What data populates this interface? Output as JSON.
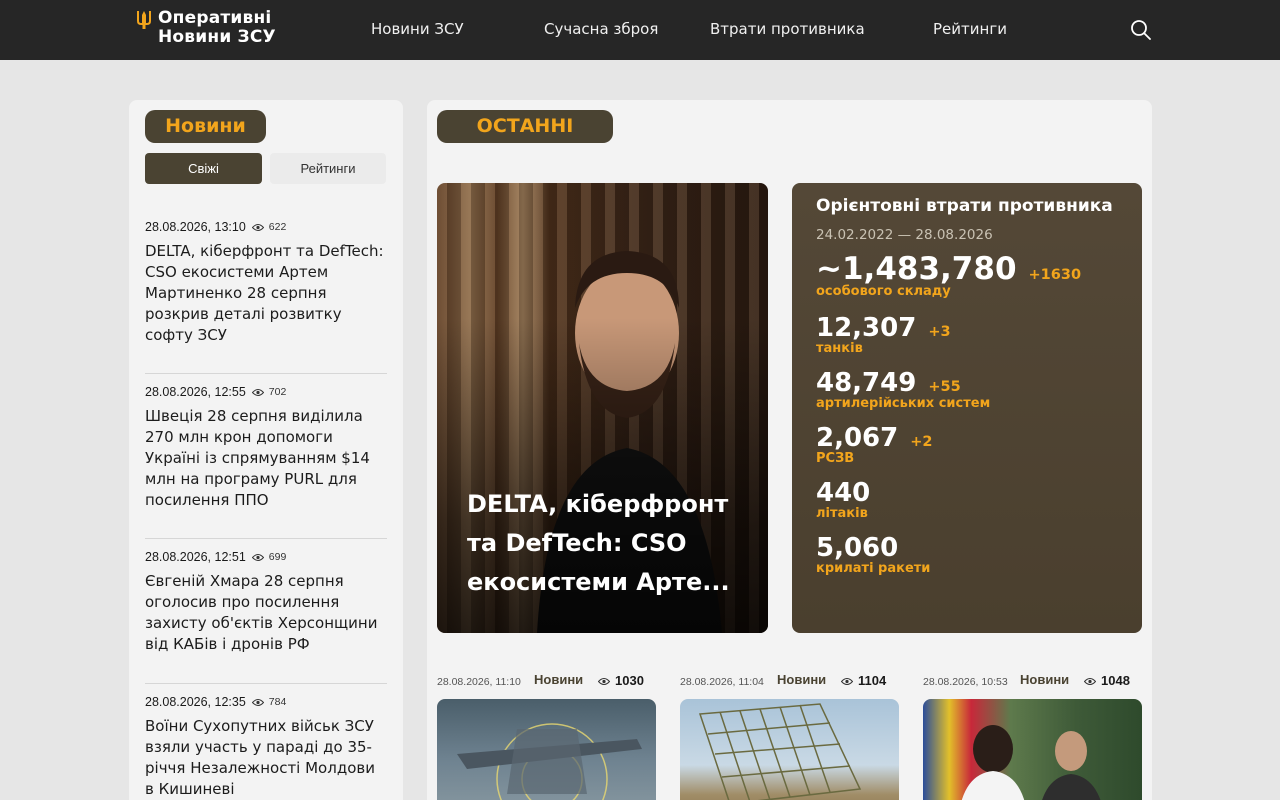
{
  "header": {
    "logo_line1": "Оперативні",
    "logo_line2": "Новини ЗСУ",
    "nav": [
      "Новини ЗСУ",
      "Сучасна зброя",
      "Втрати противника",
      "Рейтинги"
    ],
    "search_icon": "search-icon"
  },
  "sidebar": {
    "title": "Новини",
    "tabs": [
      "Свіжі",
      "Рейтинги"
    ],
    "active_tab": "Свіжі",
    "items": [
      {
        "date": "28.08.2026, 13:10",
        "views": "622",
        "title": "DELTA, кіберфронт та DefTech: CSO екосистеми Артем Мартиненко 28 серпня розкрив деталі розвитку софту ЗСУ"
      },
      {
        "date": "28.08.2026, 12:55",
        "views": "702",
        "title": "Швеція 28 серпня виділила 270 млн крон допомоги Україні із спрямуванням $14 млн на програму PURL для посилення ППО"
      },
      {
        "date": "28.08.2026, 12:51",
        "views": "699",
        "title": "Євгеній Хмара 28 серпня оголосив про посилення захисту об'єктів Херсонщини від КАБів і дронів РФ"
      },
      {
        "date": "28.08.2026, 12:35",
        "views": "784",
        "title": "Воїни Сухопутних військ ЗСУ взяли участь у параді до 35-річчя Незалежності Молдови в Кишиневі"
      }
    ]
  },
  "main": {
    "title": "ОСТАННІ",
    "hero_title": "DELTA, кіберфронт та DefTech: CSO екосистеми Арте...",
    "losses": {
      "title": "Орієнтовні втрати противника",
      "range": "24.02.2022 — 28.08.2026",
      "stats": [
        {
          "value": "~1,483,780",
          "delta": "+1630",
          "label": "особового складу"
        },
        {
          "value": "12,307",
          "delta": "+3",
          "label": "танків"
        },
        {
          "value": "48,749",
          "delta": "+55",
          "label": "артилерійських систем"
        },
        {
          "value": "2,067",
          "delta": "+2",
          "label": "РСЗВ"
        },
        {
          "value": "440",
          "delta": "",
          "label": "літаків"
        },
        {
          "value": "5,060",
          "delta": "",
          "label": "крилаті ракети"
        }
      ]
    },
    "cards": [
      {
        "date": "28.08.2026, 11:10",
        "category": "Новини",
        "views": "1030"
      },
      {
        "date": "28.08.2026, 11:04",
        "category": "Новини",
        "views": "1104"
      },
      {
        "date": "28.08.2026, 10:53",
        "category": "Новини",
        "views": "1048"
      }
    ]
  },
  "colors": {
    "accent": "#f2a51c",
    "pill": "#4a4332",
    "header": "#262626",
    "stats_bg": "#4a3f2e"
  }
}
